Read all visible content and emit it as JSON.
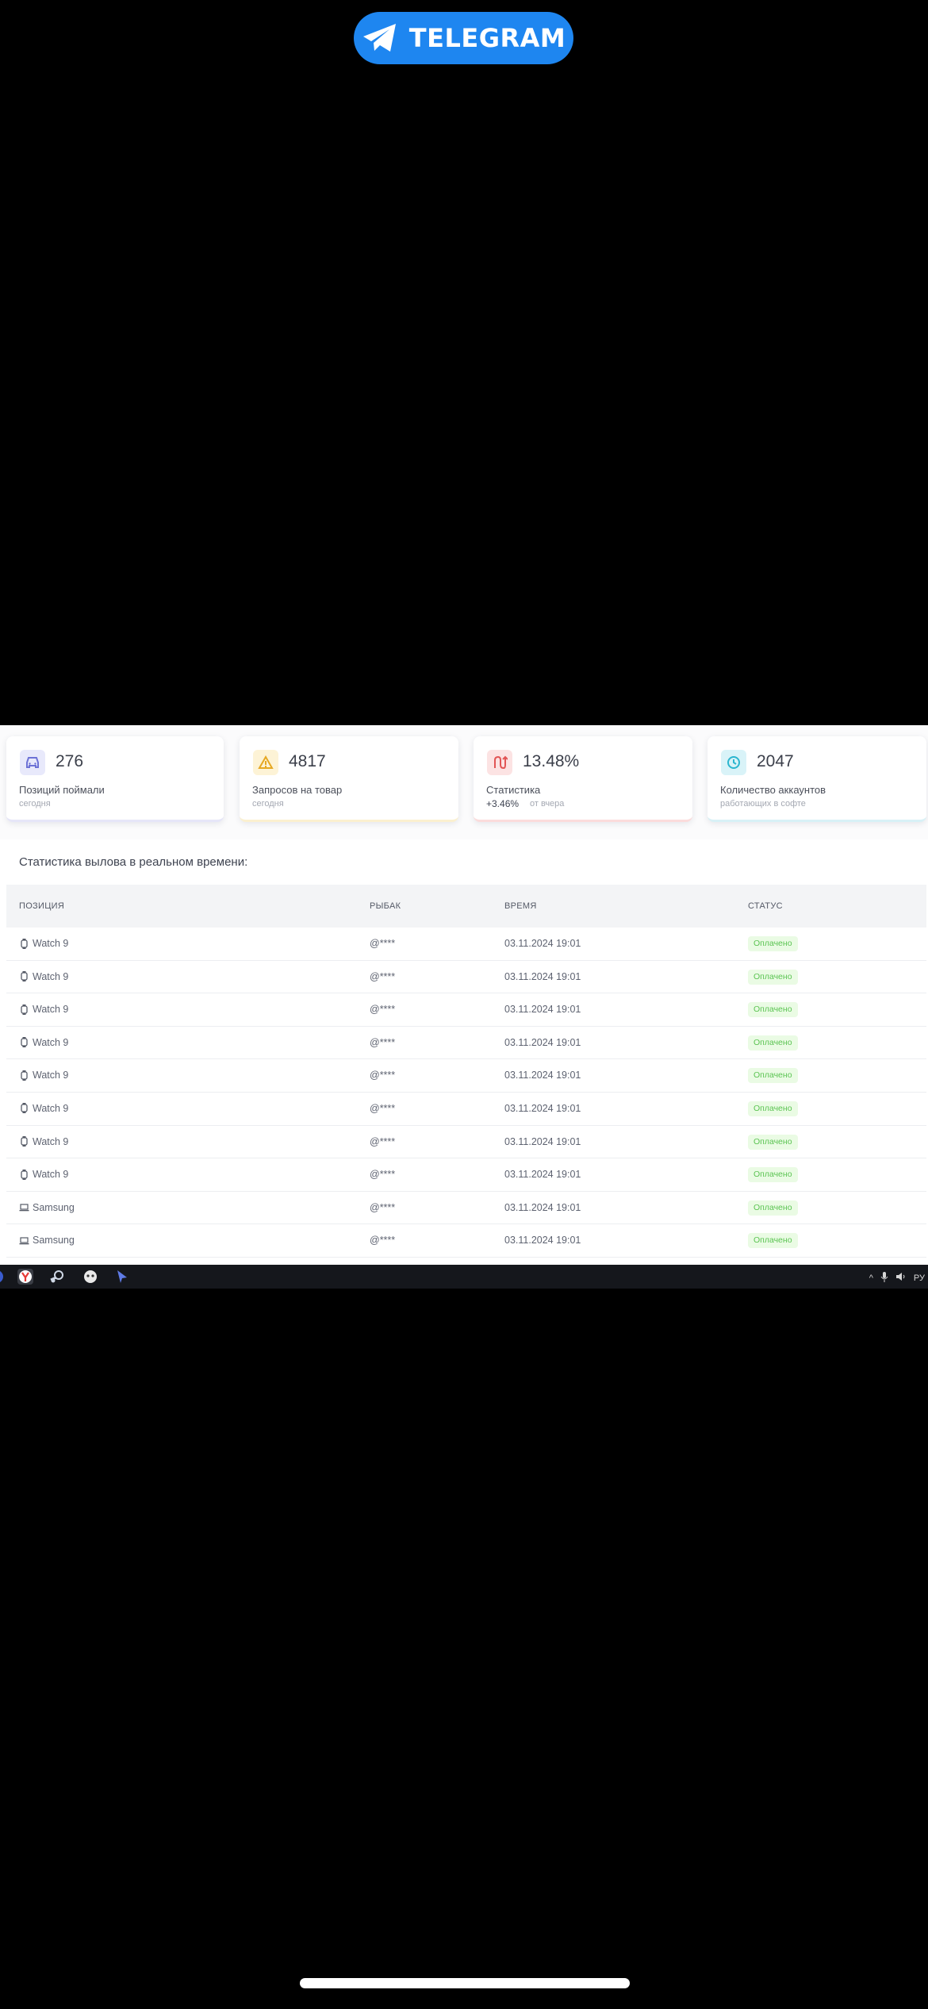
{
  "banner": {
    "label": "TELEGRAM",
    "icon": "telegram-plane-icon",
    "color": "#1e86f0"
  },
  "stats": [
    {
      "icon": "car-icon",
      "value": "276",
      "label": "Позиций поймали",
      "sub": "сегодня"
    },
    {
      "icon": "warning-icon",
      "value": "4817",
      "label": "Запросов на товар",
      "sub": "сегодня"
    },
    {
      "icon": "route-icon",
      "value": "13.48%",
      "label": "Статистика",
      "delta": "+3.46%",
      "sub": "от вчера"
    },
    {
      "icon": "clock-icon",
      "value": "2047",
      "label": "Количество аккаунтов",
      "sub": "работающих в софте"
    }
  ],
  "table": {
    "title": "Статистика вылова в реальном времени:",
    "columns": [
      "ПОЗИЦИЯ",
      "РЫБАК",
      "ВРЕМЯ",
      "СТАТУС"
    ],
    "rows": [
      {
        "icon": "watch-icon",
        "position": "Watch 9",
        "user": "@****",
        "time": "03.11.2024 19:01",
        "status": "Оплачено"
      },
      {
        "icon": "watch-icon",
        "position": "Watch 9",
        "user": "@****",
        "time": "03.11.2024 19:01",
        "status": "Оплачено"
      },
      {
        "icon": "watch-icon",
        "position": "Watch 9",
        "user": "@****",
        "time": "03.11.2024 19:01",
        "status": "Оплачено"
      },
      {
        "icon": "watch-icon",
        "position": "Watch 9",
        "user": "@****",
        "time": "03.11.2024 19:01",
        "status": "Оплачено"
      },
      {
        "icon": "watch-icon",
        "position": "Watch 9",
        "user": "@****",
        "time": "03.11.2024 19:01",
        "status": "Оплачено"
      },
      {
        "icon": "watch-icon",
        "position": "Watch 9",
        "user": "@****",
        "time": "03.11.2024 19:01",
        "status": "Оплачено"
      },
      {
        "icon": "watch-icon",
        "position": "Watch 9",
        "user": "@****",
        "time": "03.11.2024 19:01",
        "status": "Оплачено"
      },
      {
        "icon": "watch-icon",
        "position": "Watch 9",
        "user": "@****",
        "time": "03.11.2024 19:01",
        "status": "Оплачено"
      },
      {
        "icon": "laptop-icon",
        "position": "Samsung",
        "user": "@****",
        "time": "03.11.2024 19:01",
        "status": "Оплачено"
      },
      {
        "icon": "laptop-icon",
        "position": "Samsung",
        "user": "@****",
        "time": "03.11.2024 19:01",
        "status": "Оплачено"
      }
    ]
  },
  "taskbar": {
    "apps": [
      "yandex-browser-icon",
      "steam-icon",
      "app-icon",
      "cursor-icon"
    ],
    "tray": [
      "chevron-up-icon",
      "microphone-icon",
      "speaker-icon"
    ],
    "lang": "РУ"
  }
}
